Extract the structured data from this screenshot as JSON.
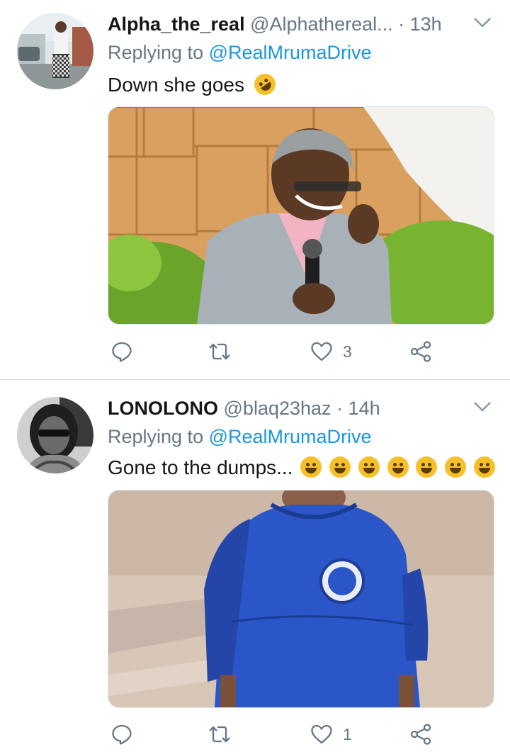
{
  "tweets": [
    {
      "name": "Alpha_the_real",
      "handle": "@Alphathereal...",
      "time": "· 13h",
      "replying_prefix": "Replying to",
      "replying_mention": "@RealMrumaDrive",
      "text": "Down she goes",
      "emojis": [
        "rolling-on-floor-laughing"
      ],
      "image_alt": "Smiling man in grey suit holding microphone in front of stone wall",
      "actions": {
        "reply_count": "",
        "retweet_count": "",
        "like_count": "3"
      }
    },
    {
      "name": "LONOLONO",
      "handle": "@blaq23haz",
      "time": "· 14h",
      "replying_prefix": "Replying to",
      "replying_mention": "@RealMrumaDrive",
      "text": "Gone to the dumps...",
      "emojis": [
        "grinning-sweat",
        "grinning-sweat",
        "grinning-sweat",
        "grinning-sweat",
        "grinning-sweat",
        "grinning-sweat",
        "hand-over-mouth"
      ],
      "image_alt": "Person in oversized blue football jersey",
      "actions": {
        "reply_count": "",
        "retweet_count": "",
        "like_count": "1"
      }
    }
  ],
  "colors": {
    "link": "#1b95e0",
    "secondary": "#657786",
    "primary_text": "#14171a",
    "divider": "#d6dce1"
  }
}
